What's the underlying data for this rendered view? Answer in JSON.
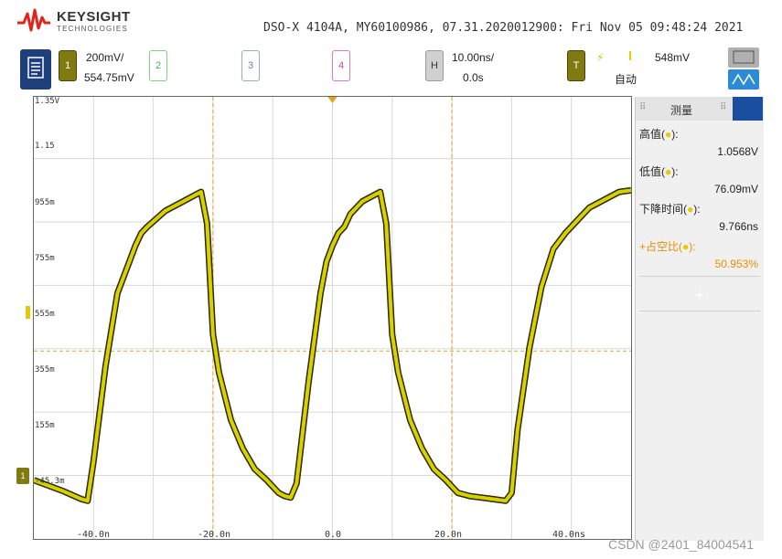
{
  "header": {
    "brand": "KEYSIGHT",
    "brand_sub": "TECHNOLOGIES",
    "title_line": "DSO-X 4104A, MY60100986, 07.31.2020012900: Fri Nov 05 09:48:24 2021"
  },
  "channels": {
    "ch1_label": "1",
    "ch1_scale": "200mV/",
    "ch1_offset": "554.75mV",
    "ch2_label": "2",
    "ch3_label": "3",
    "ch4_label": "4",
    "h_label": "H",
    "h_scale": "10.00ns/",
    "h_delay": "0.0s",
    "t_label": "T",
    "trigger_level": "548mV",
    "trigger_mode": "自动"
  },
  "plot": {
    "y_ticks": [
      "1.35V",
      "1.15",
      "955m",
      "755m",
      "555m",
      "355m",
      "155m",
      "-45.3m"
    ],
    "x_ticks": [
      "-40.0n",
      "-20.0n",
      "0.0",
      "20.0n",
      "40.0ns"
    ],
    "ch1_marker": "1"
  },
  "measurements": {
    "panel_title": "测量",
    "items": [
      {
        "label": "高值(",
        "mid": ")",
        "value": "1.0568V"
      },
      {
        "label": "低值(",
        "mid": ")",
        "value": "76.09mV"
      },
      {
        "label": "下降时间(",
        "mid": ")",
        "value": "9.766ns"
      },
      {
        "label": "+占空比(",
        "mid": ")",
        "value": "50.953%"
      }
    ],
    "add_symbol": "+"
  },
  "watermark": "CSDN @2401_84004541",
  "colors": {
    "trace": "#d8d000",
    "trace_edge": "#2a2a00",
    "grid": "#d8d8d8",
    "cursor": "#e8a020",
    "accent": "#f08c00"
  },
  "chart_data": {
    "type": "line",
    "title": "",
    "xlabel": "",
    "ylabel": "",
    "xlim": [
      -50,
      50
    ],
    "ylim": [
      -45.3,
      1350
    ],
    "x": [
      -50,
      -45,
      -42,
      -41,
      -40,
      -38,
      -36,
      -34,
      -33,
      -32,
      -31,
      -28,
      -25,
      -23,
      -22,
      -21,
      -20,
      -19,
      -17,
      -15,
      -13,
      -11,
      -10,
      -9,
      -8,
      -7,
      -6,
      -4,
      -2,
      -1,
      0,
      1,
      2,
      3,
      5,
      7,
      8,
      9,
      10,
      11,
      13,
      15,
      17,
      19,
      20,
      21,
      23,
      25,
      27,
      29,
      30,
      31,
      33,
      35,
      37,
      39,
      41,
      43,
      46,
      48,
      50
    ],
    "values": [
      140,
      105,
      80,
      75,
      200,
      500,
      730,
      830,
      880,
      920,
      940,
      990,
      1020,
      1040,
      1050,
      950,
      600,
      480,
      330,
      240,
      175,
      140,
      120,
      100,
      90,
      85,
      130,
      450,
      730,
      830,
      880,
      920,
      940,
      980,
      1020,
      1040,
      1050,
      950,
      600,
      480,
      330,
      240,
      175,
      140,
      120,
      100,
      90,
      85,
      80,
      75,
      100,
      300,
      560,
      750,
      870,
      920,
      960,
      1000,
      1030,
      1050,
      1055
    ]
  }
}
